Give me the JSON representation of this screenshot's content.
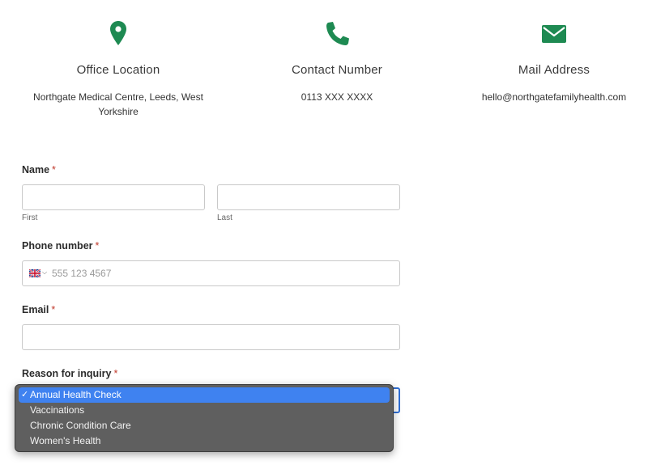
{
  "contact": {
    "office": {
      "icon": "map-pin-icon",
      "title": "Office Location",
      "text": "Northgate Medical Centre, Leeds, West Yorkshire"
    },
    "phone": {
      "icon": "phone-icon",
      "title": "Contact Number",
      "text": "0113 XXX XXXX"
    },
    "mail": {
      "icon": "envelope-icon",
      "title": "Mail Address",
      "text": "hello@northgatefamilyhealth.com"
    },
    "accent_color": "#1e8a52"
  },
  "form": {
    "required_marker": "*",
    "name": {
      "label": "Name",
      "first_value": "",
      "last_value": "",
      "first_sublabel": "First",
      "last_sublabel": "Last"
    },
    "phone": {
      "label": "Phone number",
      "country_icon": "uk-flag-icon",
      "placeholder": "555 123 4567",
      "value": ""
    },
    "email": {
      "label": "Email",
      "value": ""
    },
    "reason": {
      "label": "Reason for inquiry",
      "check_mark": "✓",
      "options": [
        "Annual Health Check",
        "Vaccinations",
        "Chronic Condition Care",
        "Women's Health"
      ],
      "selected_index": 0
    }
  }
}
